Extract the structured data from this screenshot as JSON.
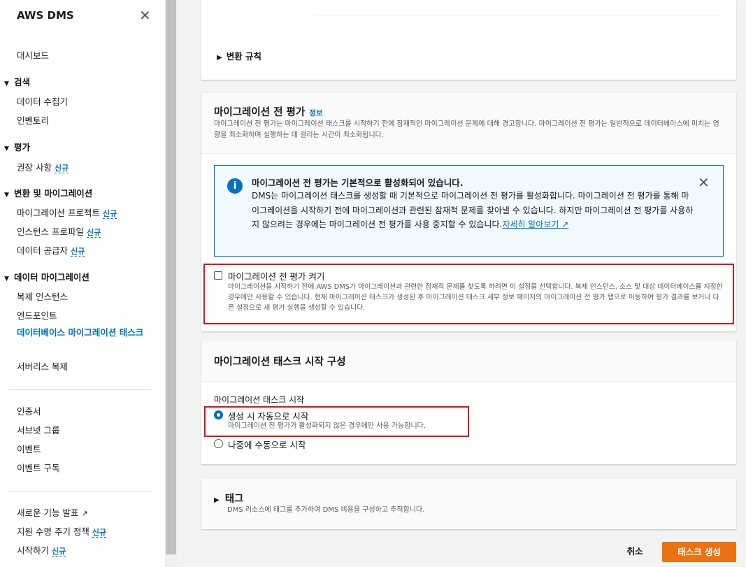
{
  "sidebar": {
    "title": "AWS DMS",
    "dashboard": "대시보드",
    "discover": {
      "label": "검색",
      "items": [
        "데이터 수집기",
        "인벤토리"
      ]
    },
    "assess": {
      "label": "평가",
      "items": [
        {
          "label": "권장 사항",
          "badge": "신규"
        }
      ]
    },
    "convert": {
      "label": "변환 및 마이그레이션",
      "items": [
        {
          "label": "마이그레이션 프로젝트",
          "badge": "신규"
        },
        {
          "label": "인스턴스 프로파일",
          "badge": "신규"
        },
        {
          "label": "데이터 공급자",
          "badge": "신규"
        }
      ]
    },
    "data_migration": {
      "label": "데이터 마이그레이션",
      "items": [
        "복제 인스턴스",
        "엔드포인트",
        "데이터베이스 마이그레이션 태스크",
        "서버리스 복제"
      ]
    },
    "misc": [
      "인증서",
      "서브넷 그룹",
      "이벤트",
      "이벤트 구독"
    ],
    "footer": [
      {
        "label": "새로운 기능 발표"
      },
      {
        "label": "지원 수명 주기 정책",
        "badge": "신규"
      },
      {
        "label": "시작하기",
        "badge": "신규"
      }
    ]
  },
  "transform_rules": {
    "label": "변환 규칙"
  },
  "premigration": {
    "title": "마이그레이션 전 평가",
    "info": "정보",
    "description": "마이그레이션 전 평가는 마이그레이션 태스크를 시작하기 전에 잠재적인 마이그레이션 문제에 대해 경고합니다. 마이그레이션 전 평가는 일반적으로 데이터베이스에 미치는 영향을 최소화하며 실행하는 데 걸리는 시간이 최소화됩니다.",
    "alert": {
      "title": "마이그레이션 전 평가는 기본적으로 활성화되어 있습니다.",
      "body": "DMS는 마이그레이션 태스크를 생성할 때 기본적으로 마이그레이션 전 평가를 활성화합니다. 마이그레이션 전 평가를 통해 마이그레이션을 시작하기 전에 마이그레이션과 관련된 잠재적 문제를 찾아낼 수 있습니다. 하지만 마이그레이션 전 평가를 사용하지 않으려는 경우에는 마이그레이션 전 평가를 사용 중지할 수 있습니다.",
      "link": "자세히 알아보기"
    },
    "checkbox": {
      "label": "마이그레이션 전 평가 켜기",
      "description": "마이그레이션을 시작하기 전에 AWS DMS가 마이그레이션과 관련한 잠재적 문제를 찾도록 하려면 이 설정을 선택합니다. 복제 인스턴스, 소스 및 대상 데이터베이스를 지정한 경우에만 사용할 수 있습니다. 현재 마이그레이션 태스크가 생성된 후 마이그레이션 태스크 세부 정보 페이지의 마이그레이션 전 평가 탭으로 이동하여 평가 결과를 보거나 다른 설정으로 새 평가 실행을 생성할 수 있습니다."
    }
  },
  "startup": {
    "title": "마이그레이션 태스크 시작 구성",
    "field_label": "마이그레이션 태스크 시작",
    "option_auto": "생성 시 자동으로 시작",
    "option_auto_desc": "마이그레이션 전 평가가 활성화되지 않은 경우에만 사용 가능합니다.",
    "option_manual": "나중에 수동으로 시작"
  },
  "tags": {
    "title": "태그",
    "description": "DMS 리소스에 태그를 추가하여 DMS 비용을 구성하고 추적합니다."
  },
  "actions": {
    "cancel": "취소",
    "create": "태스크 생성"
  }
}
